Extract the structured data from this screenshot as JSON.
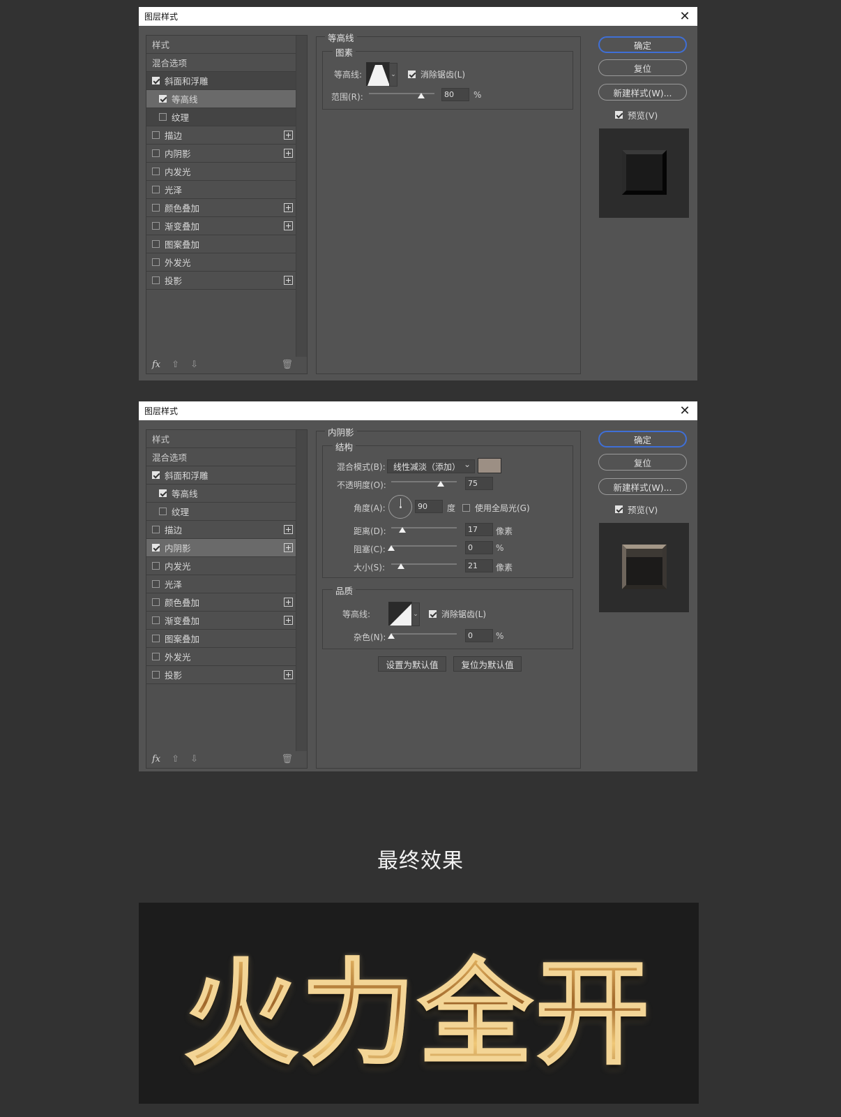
{
  "dialog_title": "图层样式",
  "styles_list": [
    {
      "label": "样式",
      "kind": "header"
    },
    {
      "label": "混合选项",
      "kind": "header"
    },
    {
      "label": "斜面和浮雕",
      "kind": "item"
    },
    {
      "label": "等高线",
      "kind": "sub"
    },
    {
      "label": "纹理",
      "kind": "sub"
    },
    {
      "label": "描边",
      "kind": "item",
      "plus": true
    },
    {
      "label": "内阴影",
      "kind": "item",
      "plus": true
    },
    {
      "label": "内发光",
      "kind": "item"
    },
    {
      "label": "光泽",
      "kind": "item"
    },
    {
      "label": "颜色叠加",
      "kind": "item",
      "plus": true
    },
    {
      "label": "渐变叠加",
      "kind": "item",
      "plus": true
    },
    {
      "label": "图案叠加",
      "kind": "item"
    },
    {
      "label": "外发光",
      "kind": "item"
    },
    {
      "label": "投影",
      "kind": "item",
      "plus": true
    }
  ],
  "footer": {
    "fx": "fx",
    "up": "⇧",
    "down": "⇩",
    "trash": "🗑"
  },
  "buttons": {
    "ok": "确定",
    "reset": "复位",
    "new_style": "新建样式(W)...",
    "preview": "预览(V)"
  },
  "dialog1": {
    "checked": [
      false,
      false,
      true,
      true,
      false,
      false,
      false,
      false,
      false,
      false,
      false,
      false,
      false,
      false
    ],
    "section_title": "等高线",
    "group_title": "图素",
    "contour_label": "等高线:",
    "antialias_label": "消除锯齿(L)",
    "range_label": "范围(R):",
    "range_value": "80",
    "range_unit": "%",
    "range_level": 0.8
  },
  "dialog2": {
    "checked": [
      false,
      false,
      true,
      true,
      false,
      false,
      true,
      false,
      false,
      false,
      false,
      false,
      false,
      false
    ],
    "section_title": "内阴影",
    "structure_title": "结构",
    "blend_label": "混合模式(B):",
    "blend_value": "线性减淡（添加）",
    "shadow_color": "#9c8f84",
    "opacity_label": "不透明度(O):",
    "opacity_value": "75",
    "opacity_level": 0.75,
    "angle_label": "角度(A):",
    "angle_value": "90",
    "angle_unit": "度",
    "global_light_label": "使用全局光(G)",
    "distance_label": "距离(D):",
    "distance_value": "17",
    "distance_unit": "像素",
    "distance_level": 0.17,
    "choke_label": "阻塞(C):",
    "choke_value": "0",
    "choke_unit": "%",
    "choke_level": 0.0,
    "size_label": "大小(S):",
    "size_value": "21",
    "size_unit": "像素",
    "size_level": 0.15,
    "quality_title": "品质",
    "contour_label": "等高线:",
    "antialias_label": "消除锯齿(L)",
    "noise_label": "杂色(N):",
    "noise_value": "0",
    "noise_unit": "%",
    "noise_level": 0.0,
    "set_default": "设置为默认值",
    "reset_default": "复位为默认值"
  },
  "result": {
    "title": "最终效果",
    "text": "火力全开"
  },
  "colors": {
    "accent_blue": "#3f6fd6",
    "panel_bg": "#535353",
    "page_bg": "#323232",
    "gold": "#d8a95a"
  }
}
